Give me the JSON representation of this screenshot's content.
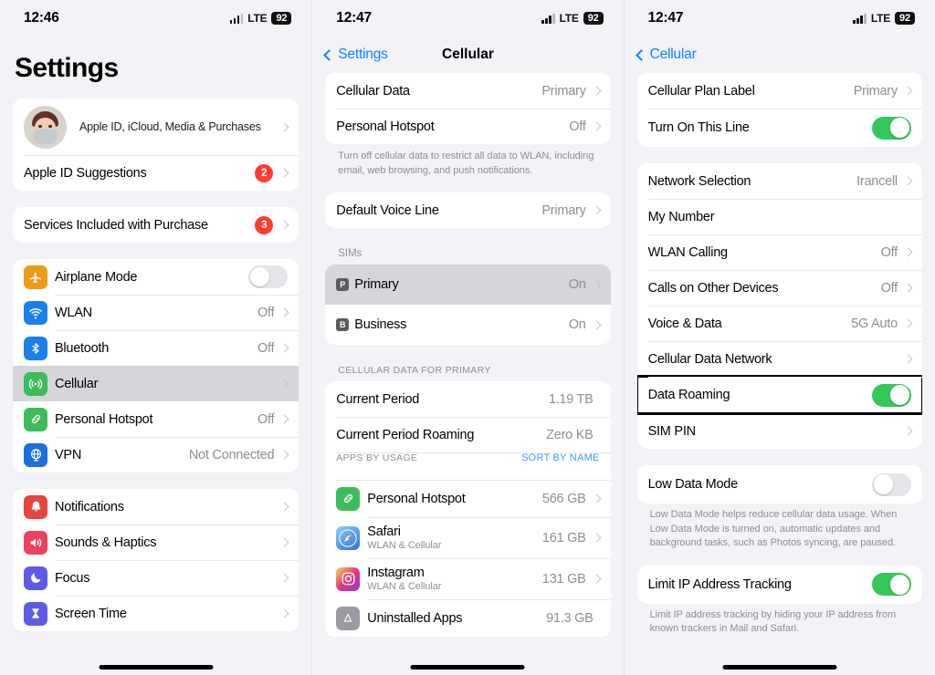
{
  "panels": [
    {
      "status": {
        "time": "12:46",
        "network": "LTE",
        "battery": "92"
      },
      "title": "Settings",
      "profile": {
        "name": "Apple ID, iCloud, Media & Purchases",
        "avatar_icon": "memoji-avatar"
      },
      "rows": {
        "apple_id_suggestions": {
          "label": "Apple ID Suggestions",
          "badge": "2"
        },
        "services_included": {
          "label": "Services Included with Purchase",
          "badge": "3"
        },
        "airplane": {
          "label": "Airplane Mode",
          "toggle": "off",
          "icon": "airplane-icon",
          "color": "#f09a1a"
        },
        "wlan": {
          "label": "WLAN",
          "value": "Off",
          "icon": "wifi-icon",
          "color": "#1b7fed"
        },
        "bluetooth": {
          "label": "Bluetooth",
          "value": "Off",
          "icon": "bluetooth-icon",
          "color": "#1b7fed"
        },
        "cellular": {
          "label": "Cellular",
          "value": "",
          "icon": "cellular-icon",
          "color": "#3bbd5c"
        },
        "hotspot": {
          "label": "Personal Hotspot",
          "value": "Off",
          "icon": "hotspot-icon",
          "color": "#3bbd5c"
        },
        "vpn": {
          "label": "VPN",
          "value": "Not Connected",
          "icon": "vpn-globe-icon",
          "color": "#1b6fe0"
        },
        "notifications": {
          "label": "Notifications",
          "icon": "notifications-icon",
          "color": "#e8453c"
        },
        "sounds": {
          "label": "Sounds & Haptics",
          "icon": "sounds-icon",
          "color": "#e8435e"
        },
        "focus": {
          "label": "Focus",
          "icon": "focus-moon-icon",
          "color": "#5e5ce6"
        },
        "screen_time": {
          "label": "Screen Time",
          "icon": "screen-time-icon",
          "color": "#5e5ce6"
        }
      }
    },
    {
      "status": {
        "time": "12:47",
        "network": "LTE",
        "battery": "92"
      },
      "back": "Settings",
      "title": "Cellular",
      "rows": {
        "cellular_data": {
          "label": "Cellular Data",
          "value": "Primary"
        },
        "personal_hotspot": {
          "label": "Personal Hotspot",
          "value": "Off"
        },
        "footnote1": "Turn off cellular data to restrict all data to WLAN, including email, web browsing, and push notifications.",
        "default_voice_line": {
          "label": "Default Voice Line",
          "value": "Primary"
        },
        "sims_header": "SIMs",
        "sim_primary": {
          "label": "Primary",
          "value": "On",
          "tag": "P"
        },
        "sim_business": {
          "label": "Business",
          "value": "On",
          "tag": "B"
        },
        "data_header": "CELLULAR DATA FOR PRIMARY",
        "current_period": {
          "label": "Current Period",
          "value": "1.19 TB"
        },
        "current_period_roaming": {
          "label": "Current Period Roaming",
          "value": "Zero KB"
        },
        "apps_header": "APPS BY USAGE",
        "sort_link": "SORT BY NAME",
        "app_hotspot": {
          "label": "Personal Hotspot",
          "sub": "",
          "value": "566 GB",
          "icon": "hotspot-icon",
          "color": "#3bbd5c"
        },
        "app_safari": {
          "label": "Safari",
          "sub": "WLAN & Cellular",
          "value": "161 GB",
          "icon": "safari-icon",
          "color": "#3b8ff0"
        },
        "app_instagram": {
          "label": "Instagram",
          "sub": "WLAN & Cellular",
          "value": "131 GB",
          "icon": "instagram-icon",
          "color": "#d6279b"
        },
        "app_uninstalled": {
          "label": "Uninstalled Apps",
          "sub": "",
          "value": "91.3 GB",
          "icon": "app-store-icon",
          "color": "#9a9aa0"
        }
      }
    },
    {
      "status": {
        "time": "12:47",
        "network": "LTE",
        "battery": "92"
      },
      "back": "Cellular",
      "title": "",
      "rows": {
        "plan_label": {
          "label": "Cellular Plan Label",
          "value": "Primary"
        },
        "turn_on_line": {
          "label": "Turn On This Line",
          "toggle": "on"
        },
        "network_selection": {
          "label": "Network Selection",
          "value": "Irancell"
        },
        "my_number": {
          "label": "My Number",
          "value": ""
        },
        "wlan_calling": {
          "label": "WLAN Calling",
          "value": "Off"
        },
        "calls_other_devices": {
          "label": "Calls on Other Devices",
          "value": "Off"
        },
        "voice_data": {
          "label": "Voice & Data",
          "value": "5G Auto"
        },
        "cellular_data_network": {
          "label": "Cellular Data Network",
          "value": ""
        },
        "data_roaming": {
          "label": "Data Roaming",
          "toggle": "on",
          "highlighted": true
        },
        "sim_pin": {
          "label": "SIM PIN",
          "value": ""
        },
        "low_data_mode": {
          "label": "Low Data Mode",
          "toggle": "off"
        },
        "footnote_low_data": "Low Data Mode helps reduce cellular data usage. When Low Data Mode is turned on, automatic updates and background tasks, such as Photos syncing, are paused.",
        "limit_ip": {
          "label": "Limit IP Address Tracking",
          "toggle": "on"
        },
        "footnote_limit_ip": "Limit IP address tracking by hiding your IP address from known trackers in Mail and Safari."
      }
    }
  ],
  "colors": {
    "accent_blue": "#0a84ff",
    "toggle_green": "#34c759",
    "badge_red": "#ff3b30",
    "gray_text": "#8e8e93"
  }
}
